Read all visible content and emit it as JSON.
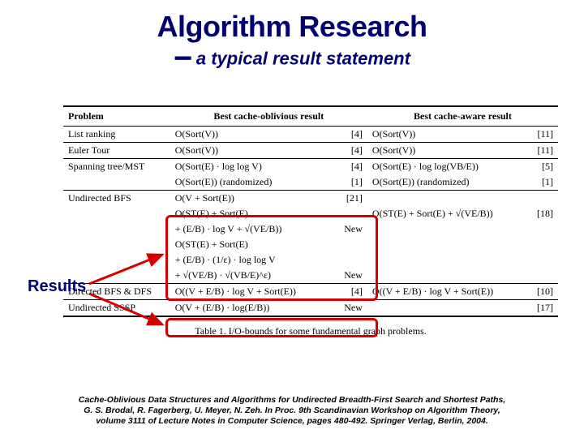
{
  "title": "Algorithm Research",
  "dash": "−",
  "subtitle": "a typical result statement",
  "headers": {
    "c1": "Problem",
    "c2": "Best cache-oblivious result",
    "c3": "Best cache-aware result"
  },
  "rows": {
    "list_ranking": {
      "p": "List ranking",
      "co": "O(Sort(V))",
      "co_ref": "[4]",
      "ca": "O(Sort(V))",
      "ca_ref": "[11]"
    },
    "euler_tour": {
      "p": "Euler Tour",
      "co": "O(Sort(V))",
      "co_ref": "[4]",
      "ca": "O(Sort(V))",
      "ca_ref": "[11]"
    },
    "spanning1": {
      "p": "Spanning tree/MST",
      "co": "O(Sort(E) · log log V)",
      "co_ref": "[4]",
      "ca": "O(Sort(E) · log log(VB/E))",
      "ca_ref": "[5]"
    },
    "spanning2": {
      "co": "O(Sort(E)) (randomized)",
      "co_ref": "[1]",
      "ca": "O(Sort(E)) (randomized)",
      "ca_ref": "[1]"
    },
    "ubfs1": {
      "p": "Undirected BFS",
      "co": "O(V + Sort(E))",
      "co_ref": "[21]"
    },
    "ubfs2": {
      "co": "O(ST(E) + Sort(E)",
      "ca": "O(ST(E) + Sort(E) + √(VE/B))",
      "ca_ref": "[18]"
    },
    "ubfs3": {
      "co": "  + (E/B) · log V + √(VE/B))",
      "co_ref": "New"
    },
    "ubfs4": {
      "co": "O(ST(E) + Sort(E)"
    },
    "ubfs5": {
      "co": "  + (E/B) · (1/ε) · log log V"
    },
    "ubfs6": {
      "co": "  + √(VE/B) · √(VB/E)^ε)",
      "co_ref": "New"
    },
    "dbfs": {
      "p": "Directed BFS & DFS",
      "co": "O((V + E/B) · log V + Sort(E))",
      "co_ref": "[4]",
      "ca": "O((V + E/B) · log V + Sort(E))",
      "ca_ref": "[10]"
    },
    "sssp": {
      "p": "Undirected SSSP",
      "co": "O(V + (E/B) · log(E/B))",
      "co_ref": "New",
      "ca": "",
      "ca_ref": "[17]"
    }
  },
  "caption": "Table 1. I/O-bounds for some fundamental graph problems.",
  "results_label": "Results",
  "citation": {
    "l1": "Cache-Oblivious Data Structures and Algorithms for Undirected Breadth-First Search and Shortest Paths,",
    "l2": "G. S. Brodal, R. Fagerberg, U. Meyer, N. Zeh. In Proc. 9th Scandinavian Workshop on Algorithm Theory,",
    "l3": "volume 3111 of Lecture Notes in Computer Science, pages 480-492. Springer Verlag, Berlin, 2004."
  }
}
